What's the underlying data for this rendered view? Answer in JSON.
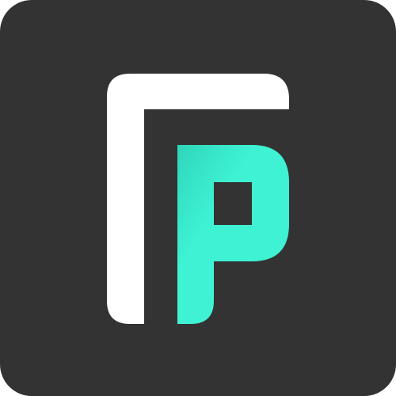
{
  "icon": {
    "name": "FP app logo",
    "colors": {
      "background": "#333333",
      "letter_f": "#ffffff",
      "letter_p": "#3ef2d3",
      "letter_p_shadow": "#2fd6ba"
    }
  }
}
